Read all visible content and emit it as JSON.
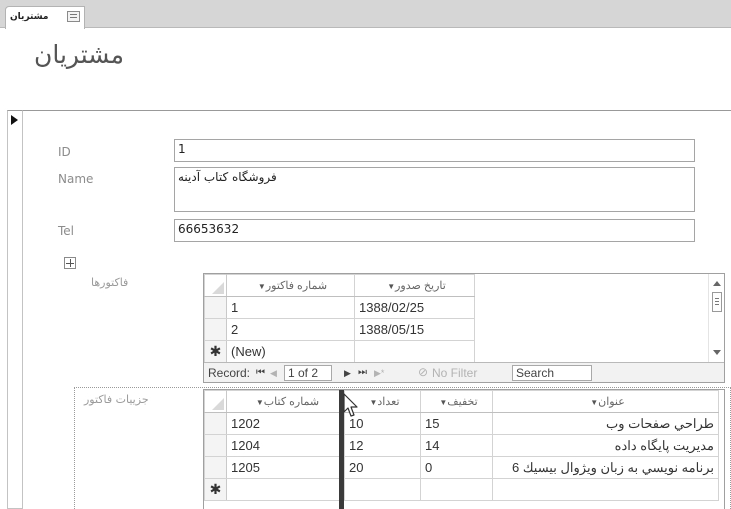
{
  "tab": {
    "label": "مشتريان",
    "icon": "form-icon"
  },
  "form": {
    "title": "مشتريان"
  },
  "fields": {
    "id": {
      "label": "ID",
      "value": "1"
    },
    "name": {
      "label": "Name",
      "value": "فروشگاه کتاب آدینه"
    },
    "tel": {
      "label": "Tel",
      "value": "66653632"
    }
  },
  "invoices": {
    "label": "فاكتورها",
    "columns": [
      "شماره فاكتور",
      "تاريخ صدور"
    ],
    "rows": [
      {
        "number": "1",
        "date": "1388/02/25"
      },
      {
        "number": "2",
        "date": "1388/05/15"
      }
    ],
    "new_row_label": "(New)",
    "nav": {
      "record_label": "Record:",
      "first": "⏮",
      "prev": "◀",
      "position": "1 of 2",
      "next": "▶",
      "last": "⏭",
      "new": "▶*",
      "filter_label": "No Filter",
      "search_label": "Search"
    }
  },
  "invoice_details": {
    "label": "جزییات فاكتور",
    "columns": [
      "شماره کتاب",
      "تعداد",
      "تخفيف",
      "عنوان"
    ],
    "rows": [
      {
        "book": "1202",
        "count": "10",
        "discount": "15",
        "title": "طراحي صفحات وب"
      },
      {
        "book": "1204",
        "count": "12",
        "discount": "14",
        "title": "مديريت پايگاه داده"
      },
      {
        "book": "1205",
        "count": "20",
        "discount": "0",
        "title": "برنامه نويسي به زبان ويژوال بيسيك 6"
      }
    ]
  },
  "colors": {
    "tabstrip": "#d6d6d6",
    "label": "#8c8c8c",
    "border": "#a5a5a5",
    "title_header_bg": "#e2e2e2"
  }
}
